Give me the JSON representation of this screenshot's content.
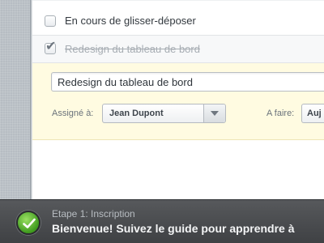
{
  "tasks": [
    {
      "label": "En cours de glisser-déposer",
      "checked": false
    },
    {
      "label": "Redesign du tableau de bord",
      "checked": true
    }
  ],
  "editor": {
    "title_value": "Redesign du tableau de bord",
    "assignee_label": "Assigné à:",
    "assignee_value": "Jean Dupont",
    "due_label": "A faire:",
    "due_value": "Auj"
  },
  "toast": {
    "step": "Etape 1: Inscription",
    "message": "Bienvenue! Suivez le guide pour apprendre à"
  },
  "colors": {
    "editor_background": "#fffbe1",
    "toast_background": "#4b4d50",
    "success_green": "#4fae2a"
  },
  "icons": {
    "checkmark": "check-icon",
    "dropdown": "chevron-down-icon",
    "toast": "success-check-icon"
  }
}
